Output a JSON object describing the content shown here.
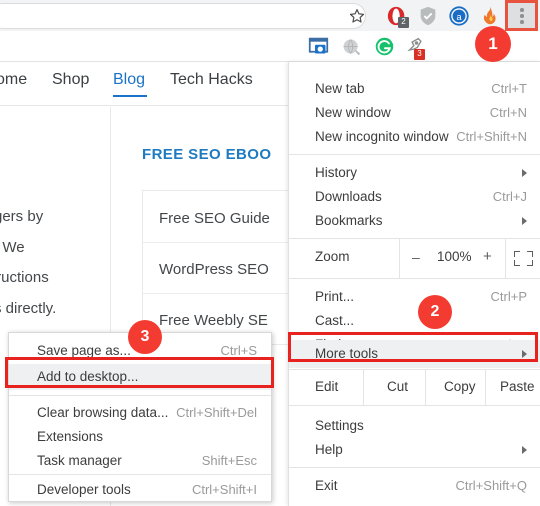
{
  "browser": {
    "star_icon": "bookmark-star-icon",
    "kebab_icon": "chrome-menu-kebab-icon",
    "extensions": [
      {
        "name": "opera-extension-icon",
        "badge": "2"
      },
      {
        "name": "shield-extension-icon",
        "badge": ""
      },
      {
        "name": "avast-extension-icon",
        "badge": ""
      },
      {
        "name": "flame-extension-icon",
        "badge": ""
      }
    ],
    "second_toolbar": [
      {
        "name": "screenshot-tool-icon",
        "badge": ""
      },
      {
        "name": "globe-tool-icon",
        "badge": ""
      },
      {
        "name": "grammarly-tool-icon",
        "badge": ""
      },
      {
        "name": "pin-tool-icon",
        "badge": "3"
      }
    ]
  },
  "webpage": {
    "nav": [
      {
        "label": "ome",
        "active": false
      },
      {
        "label": "Shop",
        "active": false
      },
      {
        "label": "Blog",
        "active": true
      },
      {
        "label": "Tech Hacks",
        "active": false
      }
    ],
    "paragraph_lines": [
      "gers by",
      ". We",
      "tructions",
      "s directly."
    ],
    "ebook_heading": "FREE SEO EBOO",
    "ebook_items": [
      "Free SEO Guide",
      "WordPress SEO",
      "Free Weebly SE"
    ]
  },
  "menu": {
    "groups": [
      {
        "items": [
          {
            "label": "New tab",
            "accel": "Ctrl+T",
            "arrow": false
          },
          {
            "label": "New window",
            "accel": "Ctrl+N",
            "arrow": false
          },
          {
            "label": "New incognito window",
            "accel": "Ctrl+Shift+N",
            "arrow": false
          }
        ]
      },
      {
        "items": [
          {
            "label": "History",
            "accel": "",
            "arrow": true
          },
          {
            "label": "Downloads",
            "accel": "Ctrl+J",
            "arrow": false
          },
          {
            "label": "Bookmarks",
            "accel": "",
            "arrow": true
          }
        ]
      }
    ],
    "zoom": {
      "label": "Zoom",
      "minus": "–",
      "value": "100%",
      "plus": "+",
      "fullscreen_icon": "fullscreen-icon"
    },
    "middle_items": [
      {
        "label": "Print...",
        "accel": "Ctrl+P",
        "arrow": false
      },
      {
        "label": "Cast...",
        "accel": "",
        "arrow": false
      },
      {
        "label": "Find...",
        "accel": "Ctrl+F",
        "arrow": false
      },
      {
        "label": "More tools",
        "accel": "",
        "arrow": true
      }
    ],
    "edit_row": {
      "label": "Edit",
      "cut": "Cut",
      "copy": "Copy",
      "paste": "Paste"
    },
    "bottom_items": [
      {
        "label": "Settings",
        "accel": "",
        "arrow": false
      },
      {
        "label": "Help",
        "accel": "",
        "arrow": true
      },
      {
        "label": "Exit",
        "accel": "Ctrl+Shift+Q",
        "arrow": false
      }
    ]
  },
  "submenu": {
    "items": [
      {
        "label": "Save page as...",
        "accel": "Ctrl+S",
        "highlight": false
      },
      {
        "label": "Add to desktop...",
        "accel": "",
        "highlight": true
      },
      {
        "label": "Clear browsing data...",
        "accel": "Ctrl+Shift+Del",
        "highlight": false
      },
      {
        "label": "Extensions",
        "accel": "",
        "highlight": false
      },
      {
        "label": "Task manager",
        "accel": "Shift+Esc",
        "highlight": false
      },
      {
        "label": "Developer tools",
        "accel": "Ctrl+Shift+I",
        "highlight": false
      }
    ]
  },
  "annotations": {
    "accent_color": "#e8231f",
    "badge_color": "#f43b31",
    "steps": [
      {
        "number": "1"
      },
      {
        "number": "2"
      },
      {
        "number": "3"
      }
    ]
  }
}
